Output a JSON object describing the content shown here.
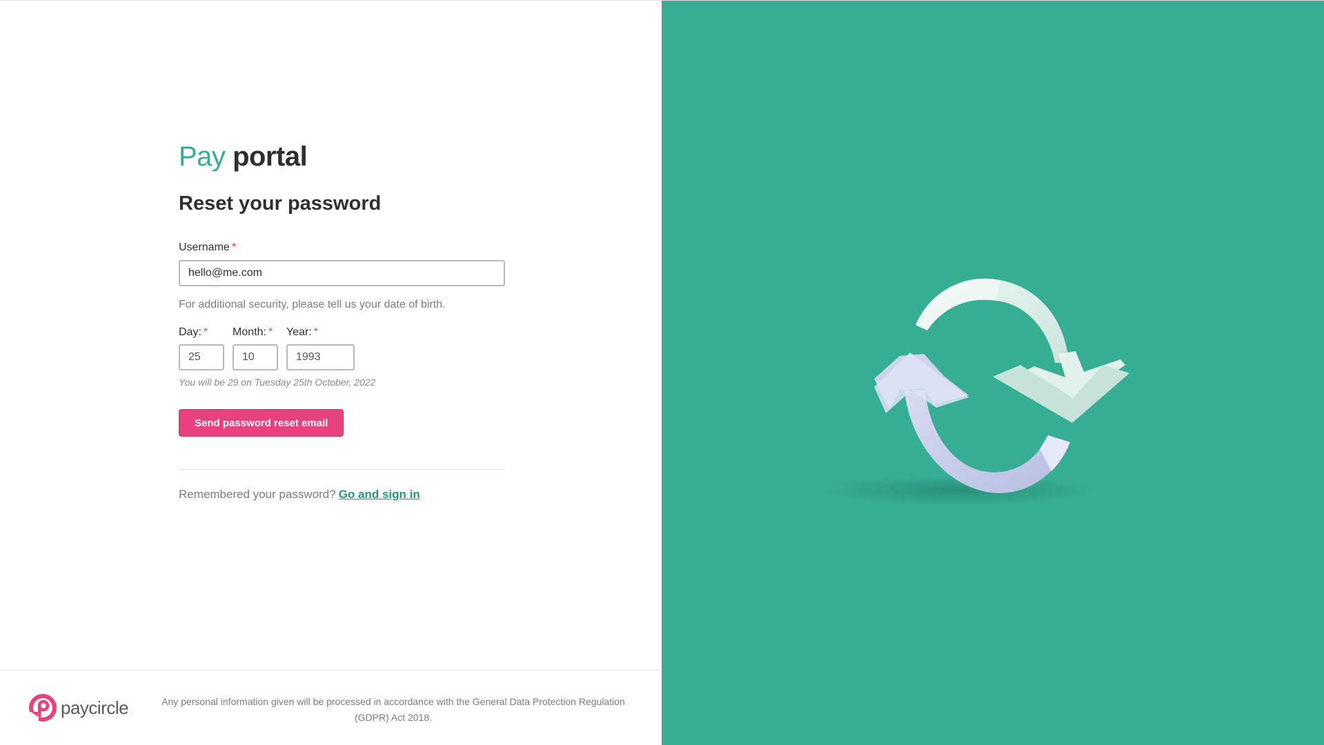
{
  "brand": {
    "accent": "Pay",
    "rest": "portal"
  },
  "heading": "Reset your password",
  "username": {
    "label": "Username",
    "required_mark": "*",
    "value": "hello@me.com"
  },
  "dob": {
    "hint": "For additional security, please tell us your date of birth.",
    "day_label": "Day:",
    "month_label": "Month:",
    "year_label": "Year:",
    "required_mark": "*",
    "day_value": "25",
    "month_value": "10",
    "year_value": "1993",
    "age_note": "You will be 29 on Tuesday 25th October, 2022"
  },
  "submit_label": "Send password reset email",
  "signin": {
    "prompt": "Remembered your password?",
    "link": "Go and sign in"
  },
  "footer": {
    "logo_text": "paycircle",
    "legal": "Any personal information given will be processed in accordance with the General Data Protection Regulation (GDPR) Act 2018."
  },
  "icons": {
    "illustration": "refresh-arrows-icon",
    "logo": "paycircle-logo-icon"
  },
  "colors": {
    "brand_green": "#36ae93",
    "brand_pink": "#e9407f",
    "link_green": "#23967d"
  }
}
